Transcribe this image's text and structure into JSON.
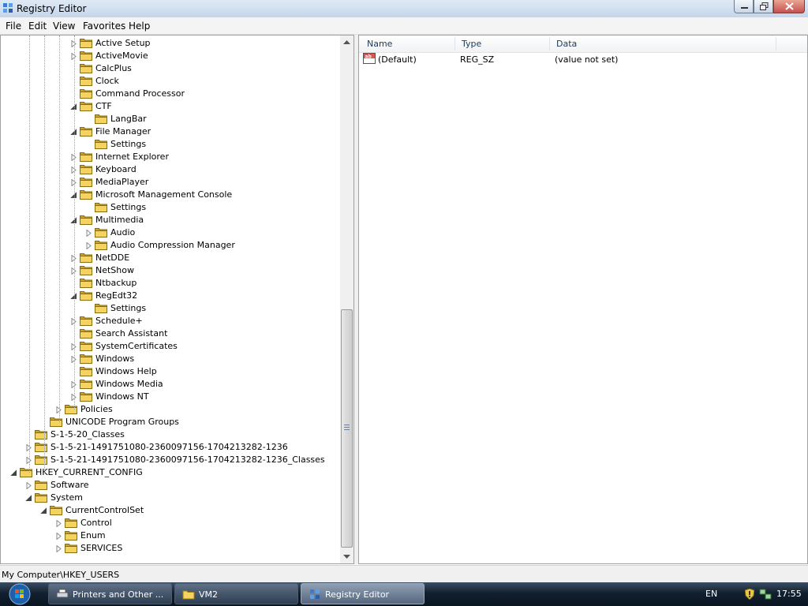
{
  "window": {
    "title": "Registry Editor",
    "menu": [
      "File",
      "Edit",
      "View",
      "Favorites",
      "Help"
    ]
  },
  "tree": [
    {
      "label": "Active Setup",
      "depth": 5,
      "arrow": "collapsed"
    },
    {
      "label": "ActiveMovie",
      "depth": 5,
      "arrow": "collapsed"
    },
    {
      "label": "CalcPlus",
      "depth": 5,
      "arrow": "none"
    },
    {
      "label": "Clock",
      "depth": 5,
      "arrow": "none"
    },
    {
      "label": "Command Processor",
      "depth": 5,
      "arrow": "none"
    },
    {
      "label": "CTF",
      "depth": 5,
      "arrow": "expanded"
    },
    {
      "label": "LangBar",
      "depth": 6,
      "arrow": "none"
    },
    {
      "label": "File Manager",
      "depth": 5,
      "arrow": "expanded"
    },
    {
      "label": "Settings",
      "depth": 6,
      "arrow": "none"
    },
    {
      "label": "Internet Explorer",
      "depth": 5,
      "arrow": "collapsed"
    },
    {
      "label": "Keyboard",
      "depth": 5,
      "arrow": "collapsed"
    },
    {
      "label": "MediaPlayer",
      "depth": 5,
      "arrow": "collapsed"
    },
    {
      "label": "Microsoft Management Console",
      "depth": 5,
      "arrow": "expanded"
    },
    {
      "label": "Settings",
      "depth": 6,
      "arrow": "none"
    },
    {
      "label": "Multimedia",
      "depth": 5,
      "arrow": "expanded"
    },
    {
      "label": "Audio",
      "depth": 6,
      "arrow": "collapsed"
    },
    {
      "label": "Audio Compression Manager",
      "depth": 6,
      "arrow": "collapsed"
    },
    {
      "label": "NetDDE",
      "depth": 5,
      "arrow": "collapsed"
    },
    {
      "label": "NetShow",
      "depth": 5,
      "arrow": "collapsed"
    },
    {
      "label": "Ntbackup",
      "depth": 5,
      "arrow": "none"
    },
    {
      "label": "RegEdt32",
      "depth": 5,
      "arrow": "expanded"
    },
    {
      "label": "Settings",
      "depth": 6,
      "arrow": "none"
    },
    {
      "label": "Schedule+",
      "depth": 5,
      "arrow": "collapsed"
    },
    {
      "label": "Search Assistant",
      "depth": 5,
      "arrow": "none"
    },
    {
      "label": "SystemCertificates",
      "depth": 5,
      "arrow": "collapsed"
    },
    {
      "label": "Windows",
      "depth": 5,
      "arrow": "collapsed"
    },
    {
      "label": "Windows Help",
      "depth": 5,
      "arrow": "none"
    },
    {
      "label": "Windows Media",
      "depth": 5,
      "arrow": "collapsed"
    },
    {
      "label": "Windows NT",
      "depth": 5,
      "arrow": "collapsed"
    },
    {
      "label": "Policies",
      "depth": 4,
      "arrow": "collapsed"
    },
    {
      "label": "UNICODE Program Groups",
      "depth": 3,
      "arrow": "none"
    },
    {
      "label": "S-1-5-20_Classes",
      "depth": 2,
      "arrow": "none"
    },
    {
      "label": "S-1-5-21-1491751080-2360097156-1704213282-1236",
      "depth": 2,
      "arrow": "collapsed"
    },
    {
      "label": "S-1-5-21-1491751080-2360097156-1704213282-1236_Classes",
      "depth": 2,
      "arrow": "collapsed"
    },
    {
      "label": "HKEY_CURRENT_CONFIG",
      "depth": 1,
      "arrow": "expanded"
    },
    {
      "label": "Software",
      "depth": 2,
      "arrow": "collapsed"
    },
    {
      "label": "System",
      "depth": 2,
      "arrow": "expanded"
    },
    {
      "label": "CurrentControlSet",
      "depth": 3,
      "arrow": "expanded"
    },
    {
      "label": "Control",
      "depth": 4,
      "arrow": "collapsed"
    },
    {
      "label": "Enum",
      "depth": 4,
      "arrow": "collapsed"
    },
    {
      "label": "SERVICES",
      "depth": 4,
      "arrow": "collapsed"
    }
  ],
  "list": {
    "columns": {
      "name": "Name",
      "type": "Type",
      "data": "Data"
    },
    "rows": [
      {
        "name": "(Default)",
        "type": "REG_SZ",
        "data": "(value not set)"
      }
    ]
  },
  "status": "My Computer\\HKEY_USERS",
  "taskbar": {
    "buttons": [
      {
        "label": "Printers and Other ...",
        "active": false
      },
      {
        "label": "VM2",
        "active": false
      },
      {
        "label": "Registry Editor",
        "active": true
      }
    ],
    "language": "EN",
    "clock": "17:55"
  },
  "colors": {
    "folder": "#f4d35e",
    "folder_dark": "#c9a227",
    "taskbar": "#12202f",
    "close_button": "#c75050"
  }
}
